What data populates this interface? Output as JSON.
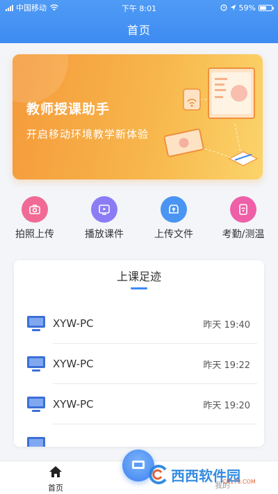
{
  "status_bar": {
    "carrier": "中国移动",
    "time": "下午 8:01",
    "battery": "59%",
    "battery_level": 0.59
  },
  "nav": {
    "title": "首页"
  },
  "banner": {
    "title": "教师授课助手",
    "subtitle": "开启移动环境教学新体验"
  },
  "quick_actions": [
    {
      "label": "拍照上传",
      "icon": "camera-icon",
      "color": "#f06a95"
    },
    {
      "label": "播放课件",
      "icon": "play-icon",
      "color": "#8b7cf5"
    },
    {
      "label": "上传文件",
      "icon": "upload-icon",
      "color": "#4a94f2"
    },
    {
      "label": "考勤/测温",
      "icon": "checkin-icon",
      "color": "#ee5fa8"
    }
  ],
  "footprint": {
    "title": "上课足迹",
    "rows": [
      {
        "name": "XYW-PC",
        "time": "昨天 19:40"
      },
      {
        "name": "XYW-PC",
        "time": "昨天 19:22"
      },
      {
        "name": "XYW-PC",
        "time": "昨天 19:20"
      }
    ]
  },
  "tabbar": {
    "home_label": "首页",
    "mine_label": "我的"
  },
  "watermark": {
    "brand": "西西软件园",
    "url": "CR173.COM"
  },
  "colors": {
    "primary": "#3d8bf2",
    "banner_orange": "#f59a3b"
  }
}
